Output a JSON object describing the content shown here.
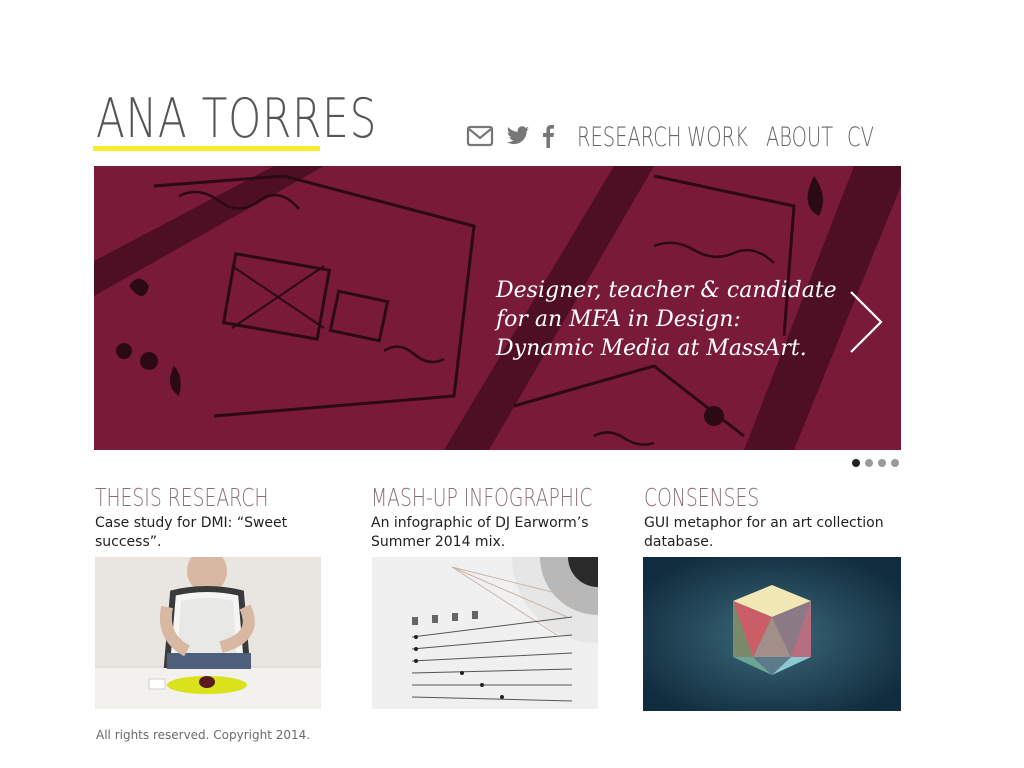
{
  "site": {
    "name": "ANA TORRES"
  },
  "header": {
    "icons": [
      "mail-icon",
      "twitter-icon",
      "facebook-icon"
    ],
    "nav": [
      {
        "label": "RESEARCH"
      },
      {
        "label": "WORK"
      },
      {
        "label": "ABOUT"
      },
      {
        "label": "CV"
      }
    ]
  },
  "hero": {
    "tagline_1": "Designer, teacher & candidate",
    "tagline_2": "for an MFA in Design:",
    "tagline_3": "Dynamic Media at MassArt.",
    "background_color": "#7a1a39",
    "slide_count": 4,
    "active_slide": 1
  },
  "projects": [
    {
      "title": "THESIS RESEARCH",
      "desc_1": "Case study for DMI: “Sweet",
      "desc_2": "success”."
    },
    {
      "title": "MASH-UP INFOGRAPHIC",
      "desc_1": "An infographic of DJ Earworm’s",
      "desc_2": "Summer 2014  mix."
    },
    {
      "title": "CONSENSES",
      "desc_1": "GUI metaphor for an art collection",
      "desc_2": "database."
    }
  ],
  "footer": {
    "text": "All rights reserved. Copyright 2014."
  },
  "colors": {
    "accent_yellow": "#f4ef2a",
    "title_color": "#8a6e76",
    "nav_color": "#666666"
  }
}
